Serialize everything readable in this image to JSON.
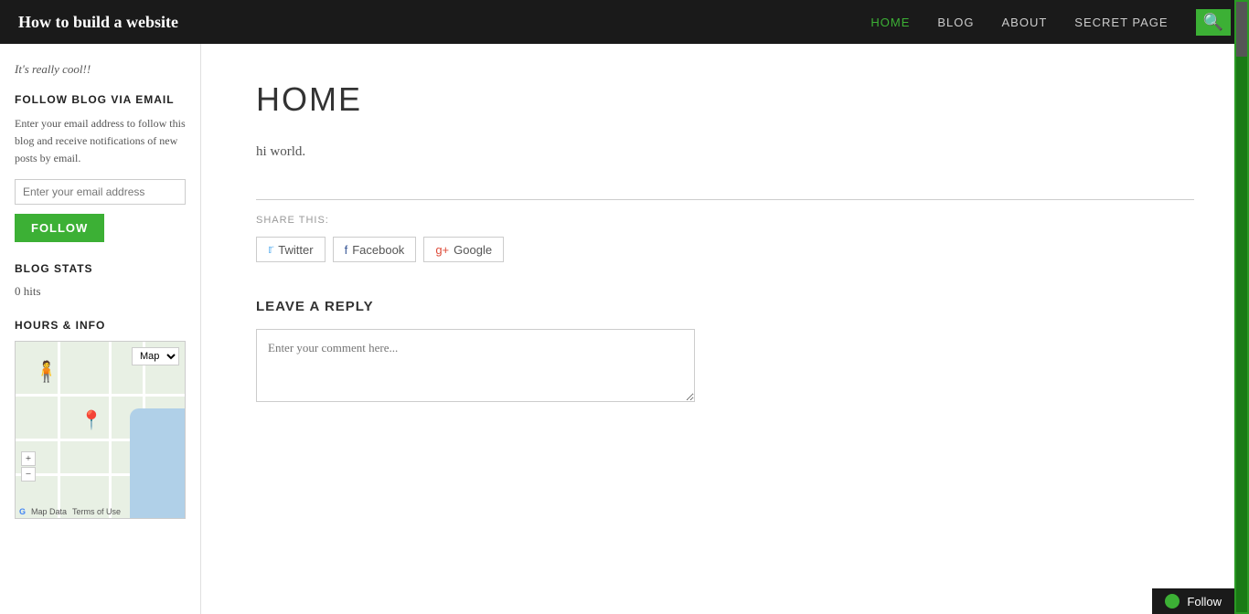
{
  "header": {
    "site_title": "How to build a website",
    "nav": [
      {
        "label": "HOME",
        "active": true
      },
      {
        "label": "BLOG",
        "active": false
      },
      {
        "label": "ABOUT",
        "active": false
      },
      {
        "label": "SECRET PAGE",
        "active": false
      }
    ],
    "search_icon": "🔍"
  },
  "sidebar": {
    "tagline": "It's really cool!!",
    "follow_email_section": {
      "title": "FOLLOW BLOG VIA EMAIL",
      "description": "Enter your email address to follow this blog and receive notifications of new posts by email.",
      "input_placeholder": "Enter your email address",
      "button_label": "FOLLOW"
    },
    "blog_stats": {
      "title": "BLOG STATS",
      "hits": "0 hits"
    },
    "hours_info": {
      "title": "HOURS & INFO"
    },
    "map": {
      "type_option": "Map",
      "footer_map_data": "Map Data",
      "footer_terms": "Terms of Use"
    }
  },
  "main": {
    "heading": "HOME",
    "body_text": "hi world.",
    "share": {
      "label": "SHARE THIS:",
      "buttons": [
        {
          "label": "Twitter",
          "icon": "twitter-icon"
        },
        {
          "label": "Facebook",
          "icon": "facebook-icon"
        },
        {
          "label": "Google",
          "icon": "google-icon"
        }
      ]
    },
    "leave_reply": {
      "title": "LEAVE A REPLY",
      "placeholder": "Enter your comment here..."
    }
  },
  "footer": {
    "follow_label": "Follow"
  }
}
